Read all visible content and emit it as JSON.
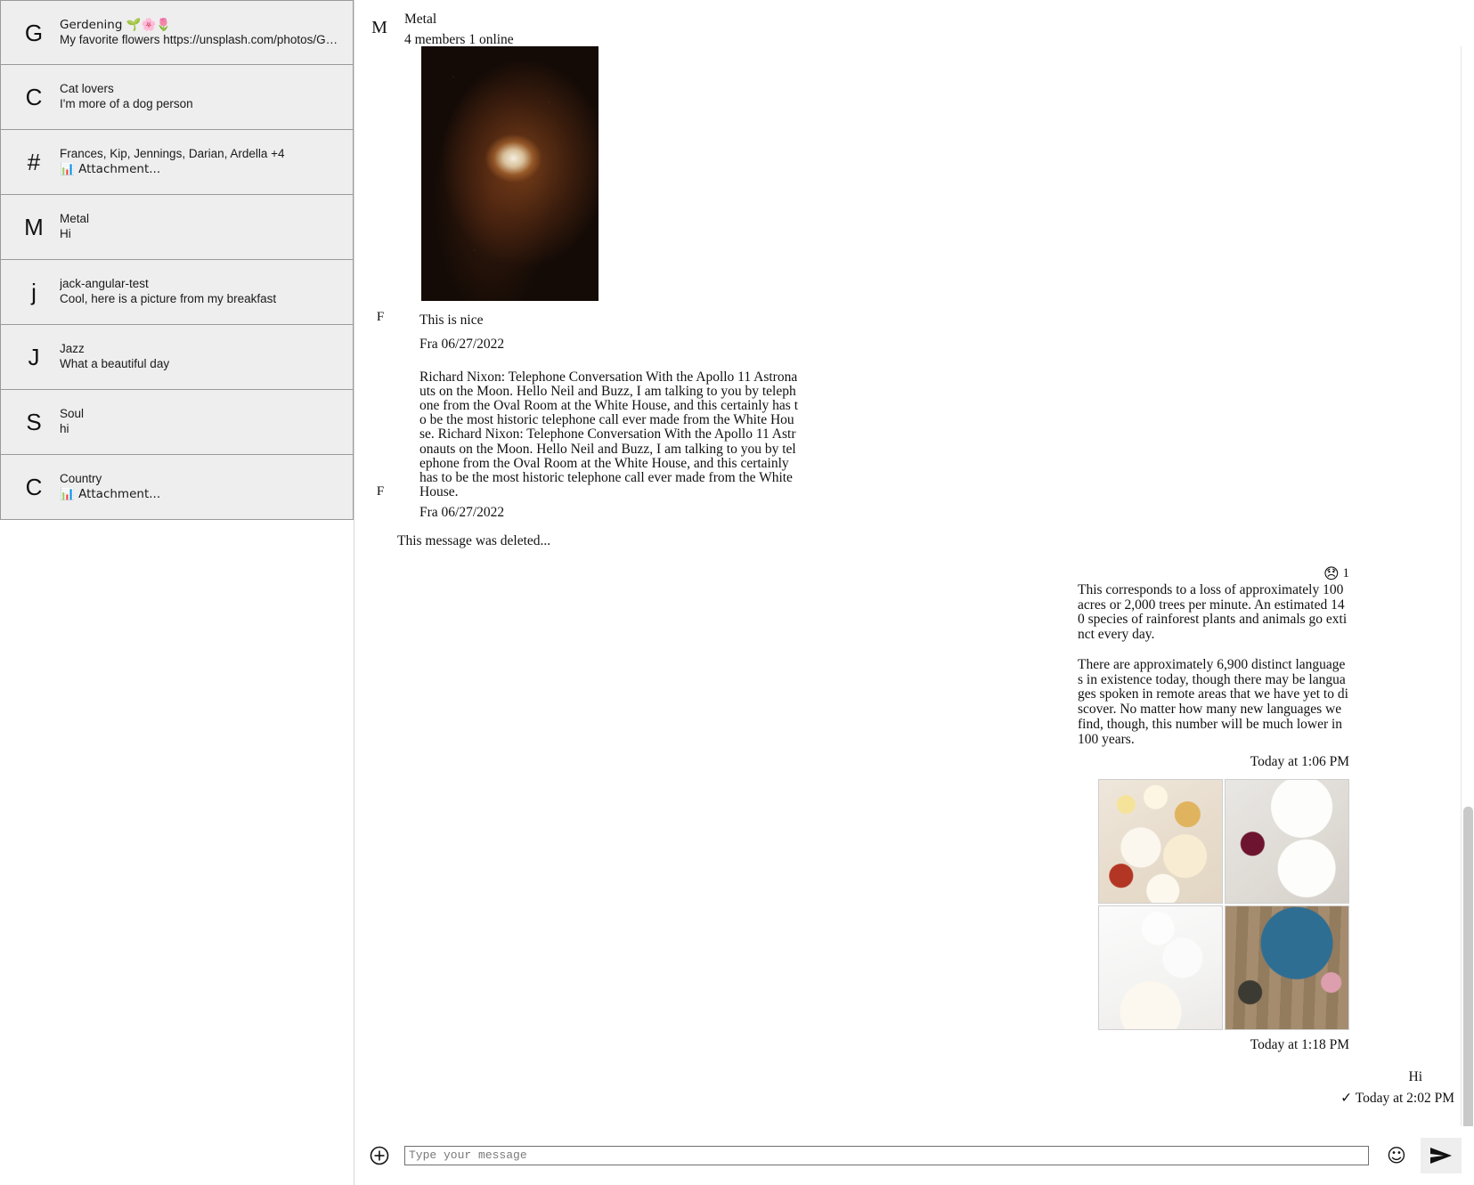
{
  "sidebar": {
    "conversations": [
      {
        "avatar": "G",
        "title": "Gerdening 🌱🌸🌷",
        "subtitle": "My favorite flowers https://unsplash.com/photos/GpDoS…"
      },
      {
        "avatar": "C",
        "title": "Cat lovers",
        "subtitle": "I'm more of a dog person"
      },
      {
        "avatar": "#",
        "title": "Frances, Kip, Jennings, Darian, Ardella +4",
        "subtitle": "📊 Attachment..."
      },
      {
        "avatar": "M",
        "title": "Metal",
        "subtitle": "Hi"
      },
      {
        "avatar": "j",
        "title": "jack-angular-test",
        "subtitle": "Cool, here is a picture from my breakfast"
      },
      {
        "avatar": "J",
        "title": "Jazz",
        "subtitle": "What a beautiful day"
      },
      {
        "avatar": "S",
        "title": "Soul",
        "subtitle": "hi"
      },
      {
        "avatar": "C",
        "title": "Country",
        "subtitle": "📊 Attachment..."
      }
    ]
  },
  "header": {
    "avatar": "M",
    "title": "Metal",
    "members": "4 members 1 online"
  },
  "messages": {
    "nebula_image_alt": "nebula-photo",
    "incoming_1": {
      "avatar": "F",
      "text": "This is nice",
      "meta": "Fra 06/27/2022"
    },
    "incoming_2": {
      "avatar": "F",
      "text": "Richard Nixon: Telephone Conversation With the Apollo 11 Astronauts on the Moon. Hello Neil and Buzz, I am talking to you by telephone from the Oval Room at the White House, and this certainly has to be the most historic telephone call ever made from the White House. Richard Nixon: Telephone Conversation With the Apollo 11 Astronauts on the Moon. Hello Neil and Buzz, I am talking to you by telephone from the Oval Room at the White House, and this certainly has to be the most historic telephone call ever made from the White House.",
      "meta": "Fra 06/27/2022"
    },
    "deleted_notice": "This message was deleted...",
    "reaction": {
      "emoji": "😞",
      "count": "1"
    },
    "outgoing_1": {
      "paragraph_1": "This corresponds to a loss of approximately 100 acres or 2,000 trees per minute. An estimated 140 species of rainforest plants and animals go extinct every day.",
      "paragraph_2": "There are approximately 6,900 distinct languages in existence today, though there may be languages spoken in remote areas that we have yet to discover. No matter how many new languages we find, though, this number will be much lower in 100 years.",
      "timestamp": "Today at 1:06 PM"
    },
    "outgoing_gallery": {
      "images": [
        "brunch-table-photo",
        "pasta-bowls-photo",
        "coffee-breakfast-photo",
        "salad-board-photo"
      ],
      "timestamp": "Today at 1:18 PM"
    },
    "outgoing_last": {
      "text": "Hi",
      "status_icon": "✓",
      "timestamp": "Today at 2:02 PM"
    }
  },
  "composer": {
    "attach_icon": "plus-circle-icon",
    "input_value": "",
    "input_placeholder": "Type your message",
    "emoji_icon": "☺",
    "send_icon": "send-icon"
  },
  "colors": {
    "sidebar_item_bg": "#eeeeee",
    "sidebar_item_border": "#9a9a9a",
    "text": "#111111",
    "send_button_bg": "#eeeeee",
    "scrollbar_thumb": "#c9c9c9"
  }
}
